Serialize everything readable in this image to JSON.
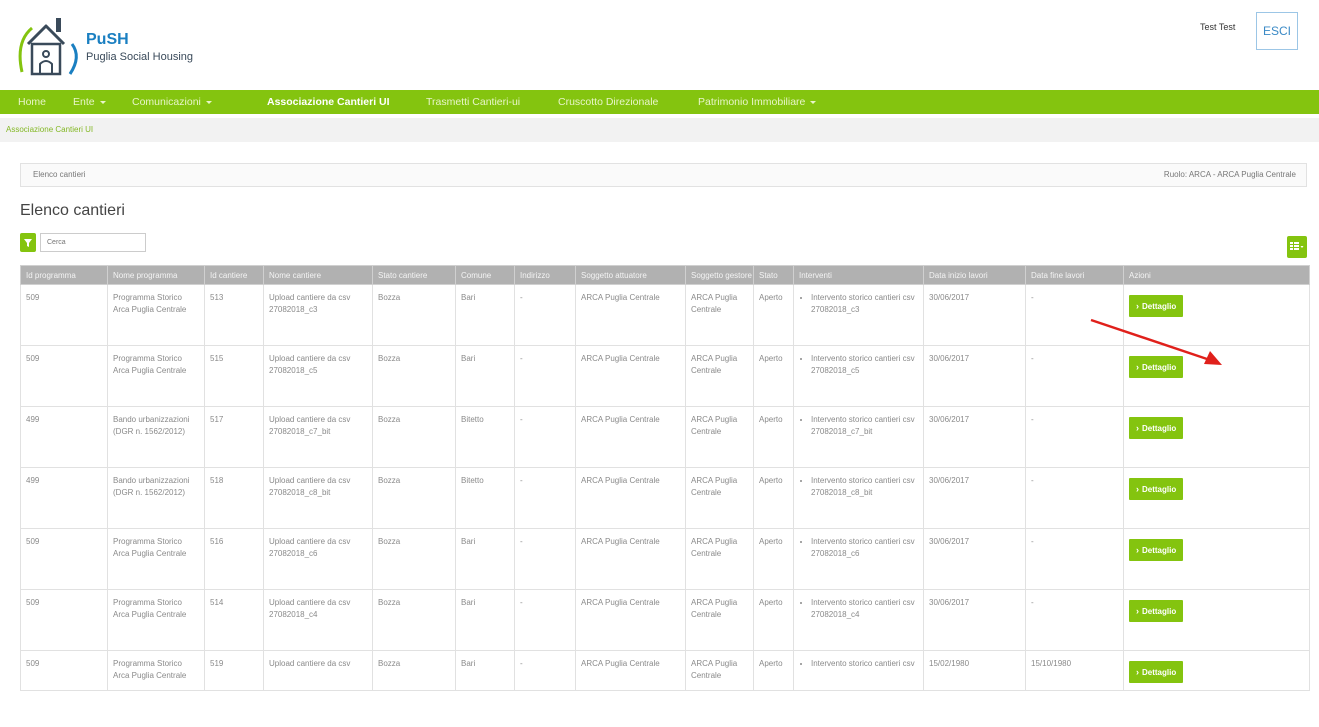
{
  "header": {
    "logo_title": "PuSH",
    "logo_subtitle": "Puglia Social Housing",
    "user_name": "Test Test",
    "logout_label": "ESCI"
  },
  "nav": {
    "items": [
      {
        "label": "Home",
        "dropdown": false,
        "active": false
      },
      {
        "label": "Ente",
        "dropdown": true,
        "active": false
      },
      {
        "label": "Comunicazioni",
        "dropdown": true,
        "active": false
      },
      {
        "label": "Associazione Cantieri UI",
        "dropdown": false,
        "active": true
      },
      {
        "label": "Trasmetti Cantieri-ui",
        "dropdown": false,
        "active": false
      },
      {
        "label": "Cruscotto Direzionale",
        "dropdown": false,
        "active": false
      },
      {
        "label": "Patrimonio Immobiliare",
        "dropdown": true,
        "active": false
      }
    ]
  },
  "breadcrumb": "Associazione Cantieri UI",
  "panel": {
    "heading": "Elenco cantieri",
    "role": "Ruolo: ARCA - ARCA Puglia Centrale"
  },
  "page_title": "Elenco cantieri",
  "filter": {
    "placeholder": "Cerca"
  },
  "table": {
    "columns": [
      "Id programma",
      "Nome programma",
      "Id cantiere",
      "Nome cantiere",
      "Stato cantiere",
      "Comune",
      "Indirizzo",
      "Soggetto attuatore",
      "Soggetto gestore",
      "Stato",
      "Interventi",
      "Data inizio lavori",
      "Data fine lavori",
      "Azioni"
    ],
    "action_label": "Dettaglio",
    "rows": [
      {
        "id_programma": "509",
        "nome_programma": "Programma Storico Arca Puglia Centrale",
        "id_cantiere": "513",
        "nome_cantiere": "Upload cantiere da csv 27082018_c3",
        "stato_cantiere": "Bozza",
        "comune": "Bari",
        "indirizzo": "-",
        "soggetto_attuatore": "ARCA Puglia Centrale",
        "soggetto_gestore": "ARCA Puglia Centrale",
        "stato": "Aperto",
        "intervento": "Intervento storico cantieri csv 27082018_c3",
        "data_inizio": "30/06/2017",
        "data_fine": "-"
      },
      {
        "id_programma": "509",
        "nome_programma": "Programma Storico Arca Puglia Centrale",
        "id_cantiere": "515",
        "nome_cantiere": "Upload cantiere da csv 27082018_c5",
        "stato_cantiere": "Bozza",
        "comune": "Bari",
        "indirizzo": "-",
        "soggetto_attuatore": "ARCA Puglia Centrale",
        "soggetto_gestore": "ARCA Puglia Centrale",
        "stato": "Aperto",
        "intervento": "Intervento storico cantieri csv 27082018_c5",
        "data_inizio": "30/06/2017",
        "data_fine": "-"
      },
      {
        "id_programma": "499",
        "nome_programma": "Bando urbanizzazioni (DGR n. 1562/2012)",
        "id_cantiere": "517",
        "nome_cantiere": "Upload cantiere da csv 27082018_c7_bit",
        "stato_cantiere": "Bozza",
        "comune": "Bitetto",
        "indirizzo": "-",
        "soggetto_attuatore": "ARCA Puglia Centrale",
        "soggetto_gestore": "ARCA Puglia Centrale",
        "stato": "Aperto",
        "intervento": "Intervento storico cantieri csv 27082018_c7_bit",
        "data_inizio": "30/06/2017",
        "data_fine": "-"
      },
      {
        "id_programma": "499",
        "nome_programma": "Bando urbanizzazioni (DGR n. 1562/2012)",
        "id_cantiere": "518",
        "nome_cantiere": "Upload cantiere da csv 27082018_c8_bit",
        "stato_cantiere": "Bozza",
        "comune": "Bitetto",
        "indirizzo": "-",
        "soggetto_attuatore": "ARCA Puglia Centrale",
        "soggetto_gestore": "ARCA Puglia Centrale",
        "stato": "Aperto",
        "intervento": "Intervento storico cantieri csv 27082018_c8_bit",
        "data_inizio": "30/06/2017",
        "data_fine": "-"
      },
      {
        "id_programma": "509",
        "nome_programma": "Programma Storico Arca Puglia Centrale",
        "id_cantiere": "516",
        "nome_cantiere": "Upload cantiere da csv 27082018_c6",
        "stato_cantiere": "Bozza",
        "comune": "Bari",
        "indirizzo": "-",
        "soggetto_attuatore": "ARCA Puglia Centrale",
        "soggetto_gestore": "ARCA Puglia Centrale",
        "stato": "Aperto",
        "intervento": "Intervento storico cantieri csv 27082018_c6",
        "data_inizio": "30/06/2017",
        "data_fine": "-"
      },
      {
        "id_programma": "509",
        "nome_programma": "Programma Storico Arca Puglia Centrale",
        "id_cantiere": "514",
        "nome_cantiere": "Upload cantiere da csv 27082018_c4",
        "stato_cantiere": "Bozza",
        "comune": "Bari",
        "indirizzo": "-",
        "soggetto_attuatore": "ARCA Puglia Centrale",
        "soggetto_gestore": "ARCA Puglia Centrale",
        "stato": "Aperto",
        "intervento": "Intervento storico cantieri csv 27082018_c4",
        "data_inizio": "30/06/2017",
        "data_fine": "-"
      },
      {
        "id_programma": "509",
        "nome_programma": "Programma Storico Arca Puglia Centrale",
        "id_cantiere": "519",
        "nome_cantiere": "Upload cantiere da csv",
        "stato_cantiere": "Bozza",
        "comune": "Bari",
        "indirizzo": "-",
        "soggetto_attuatore": "ARCA Puglia Centrale",
        "soggetto_gestore": "ARCA Puglia Centrale",
        "stato": "Aperto",
        "intervento": "Intervento storico cantieri csv",
        "data_inizio": "15/02/1980",
        "data_fine": "15/10/1980"
      }
    ]
  },
  "colors": {
    "accent": "#84c40f",
    "header_blue": "#1a7fc1",
    "table_header": "#b1b1b1",
    "annotation_arrow": "#e0201b"
  },
  "icons": {
    "filter": "filter-icon",
    "grid": "grid-columns-icon",
    "chevron": "chevron-right-icon",
    "house": "house-logo-icon"
  }
}
